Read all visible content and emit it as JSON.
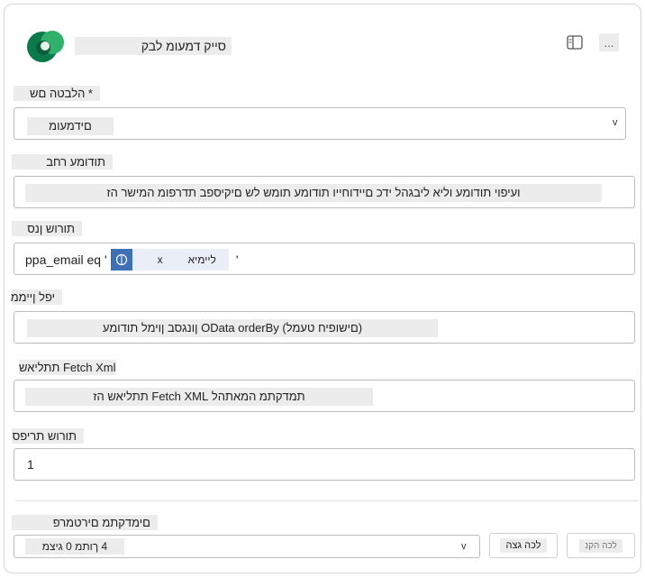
{
  "header": {
    "title": "סייק דמעומ לבק",
    "panel_icon": "panel-icon",
    "more_label": "..."
  },
  "table_name": {
    "label": "* הלבטה םש",
    "value": "םידמעומ",
    "chevron": "v"
  },
  "description": {
    "label": "תודומע רחב",
    "value": "ועיפוי תודומע וליא ליבגהל ידכ םיידוחייו תודומע תומש לש םיקיספב תדרפומ המישר הז"
  },
  "filter_rows": {
    "label": "תורוש ןנס",
    "prefix": "ppa_email eq '",
    "token_label": "ליימיא",
    "token_close": "x",
    "suffix": "'"
  },
  "sort_by": {
    "label": "יפל ןייממ",
    "value": "(םישופיח טעמל) OData orderBy ןונגסב ןוימל תודומע"
  },
  "fetch_xml": {
    "label": "Fetch Xml תתליאש",
    "value": "תמדקתמ המאתהל Fetch XML תתליאש הז"
  },
  "row_count": {
    "label": "תורוש תריפס",
    "value": "1"
  },
  "advanced": {
    "label": "םימדקתמ םירטמרפ",
    "select_value": "4 ךותמ 0 גיצמ",
    "chevron": "v",
    "show_all_button": "לכה גצה",
    "clear_all_button": "לכה הקנ"
  }
}
